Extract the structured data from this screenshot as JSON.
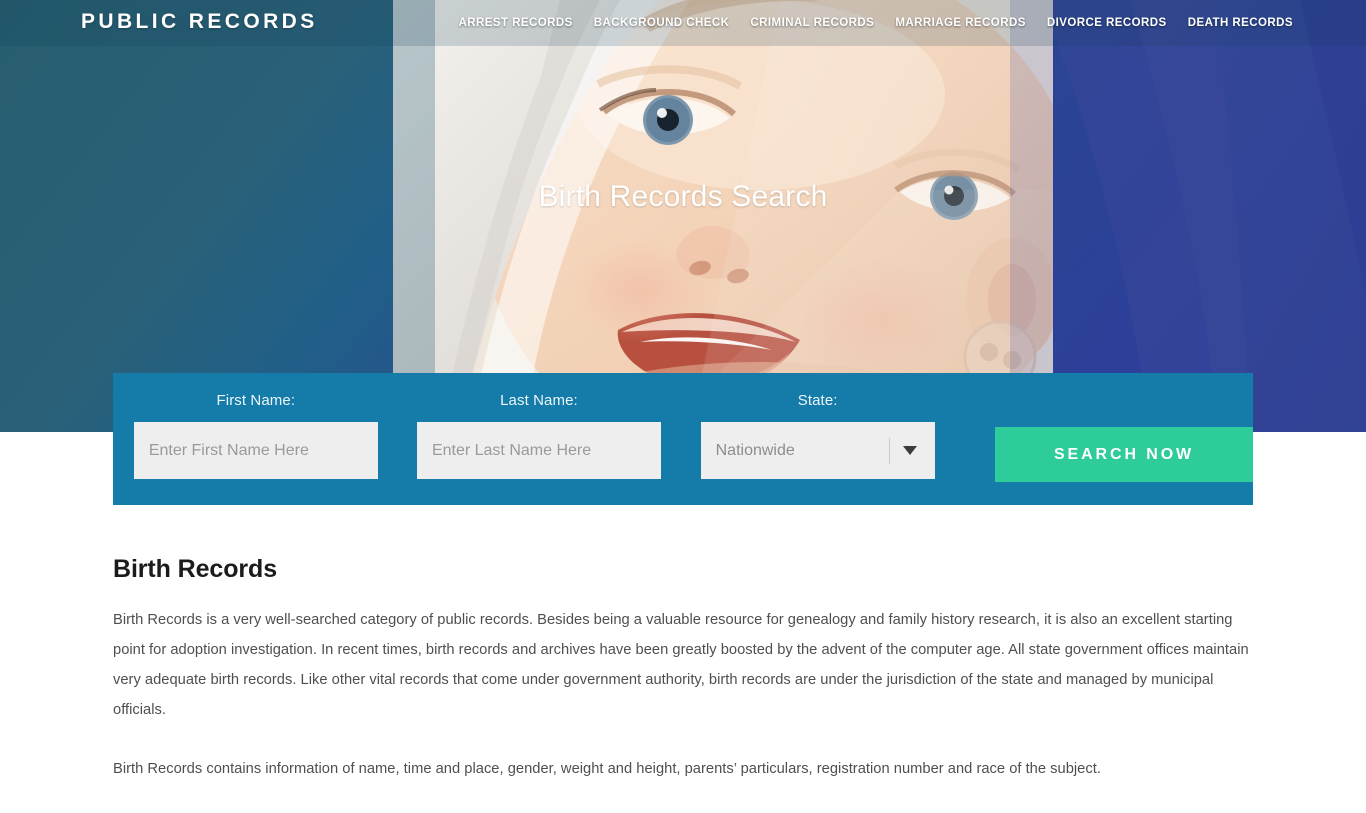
{
  "header": {
    "logo": "PUBLIC RECORDS",
    "nav": [
      {
        "label": "ARREST RECORDS"
      },
      {
        "label": "BACKGROUND CHECK"
      },
      {
        "label": "CRIMINAL RECORDS"
      },
      {
        "label": "MARRIAGE RECORDS"
      },
      {
        "label": "DIVORCE RECORDS"
      },
      {
        "label": "DEATH RECORDS"
      }
    ]
  },
  "hero": {
    "title": "Birth Records Search",
    "image_subject": "close-up photo of a smiling baby wrapped in a white blanket",
    "gradient_left": "#275d6e",
    "gradient_right": "#2c3f9a"
  },
  "search_form": {
    "panel_color": "#157ba8",
    "first_name": {
      "label": "First Name:",
      "placeholder": "Enter First Name Here",
      "value": ""
    },
    "last_name": {
      "label": "Last Name:",
      "placeholder": "Enter Last Name Here",
      "value": ""
    },
    "state": {
      "label": "State:",
      "selected": "Nationwide"
    },
    "submit": {
      "label": "SEARCH NOW",
      "color": "#2ecc9b"
    }
  },
  "main": {
    "title": "Birth Records",
    "paragraphs": [
      "Birth Records is a very well-searched category of public records. Besides being a valuable resource for genealogy and family history research, it is also an excellent starting point for adoption investigation. In recent times, birth records and archives have been greatly boosted by the advent of the computer age. All state government offices maintain very adequate birth records. Like other vital records that come under government authority, birth records are under the jurisdiction of the state and managed by municipal officials.",
      "Birth Records contains information of name, time and place, gender, weight and height, parents’ particulars, registration number and race of the subject."
    ]
  }
}
